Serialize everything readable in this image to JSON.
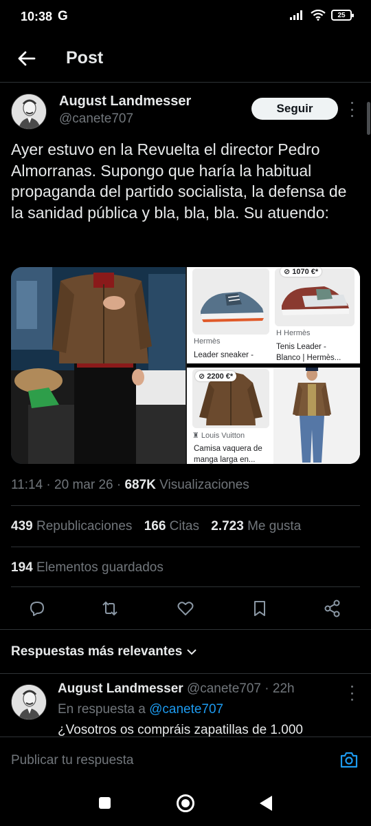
{
  "status_bar": {
    "time": "10:38",
    "g_label": "G",
    "battery": "25"
  },
  "header": {
    "title": "Post"
  },
  "post": {
    "author_name": "August Landmesser",
    "author_handle": "@canete707",
    "follow_label": "Seguir",
    "text": "Ayer estuvo en la Revuelta el director Pedro Almorranas. Supongo que haría la habitual propaganda del partido socialista, la defensa de la sanidad pública y bla, bla, bla. Su atuendo:",
    "time": "11:14",
    "date": "20 mar 26",
    "views_count": "687K",
    "views_label": "Visualizaciones",
    "reposts_count": "439",
    "reposts_label": "Republicaciones",
    "quotes_count": "166",
    "quotes_label": "Citas",
    "likes_count": "2.723",
    "likes_label": "Me gusta",
    "bookmarks_count": "194",
    "bookmarks_label": "Elementos guardados"
  },
  "media": {
    "products": [
      {
        "price": "",
        "brand": "Hermès",
        "title": "Leader sneaker -"
      },
      {
        "price": "1070 €*",
        "brand": "Hermès",
        "title_line1": "Tenis Leader -",
        "title_line2": "Blanco | Hermès..."
      },
      {
        "price": "2200 €*",
        "brand": "Louis Vuitton",
        "title_line1": "Camisa vaquera de",
        "title_line2": "manga larga en..."
      }
    ],
    "colors": {
      "shoe_blue": "#56728a",
      "shoe_red": "#8a3a30",
      "jacket_brown": "#6b4a2e"
    }
  },
  "actions": [
    "reply-icon",
    "repost-icon",
    "like-icon",
    "bookmark-icon",
    "share-icon"
  ],
  "replies": {
    "sort_label": "Respuestas más relevantes",
    "first": {
      "author_name": "August Landmesser",
      "author_handle": "@canete707",
      "age": "22h",
      "in_reply_prefix": "En respuesta a",
      "in_reply_mention": "@canete707",
      "text": "¿Vosotros os compráis zapatillas de 1.000"
    }
  },
  "compose": {
    "placeholder": "Publicar tu respuesta"
  },
  "colors": {
    "accent": "#1d9bf0",
    "background": "#000000",
    "muted": "#71767b"
  }
}
